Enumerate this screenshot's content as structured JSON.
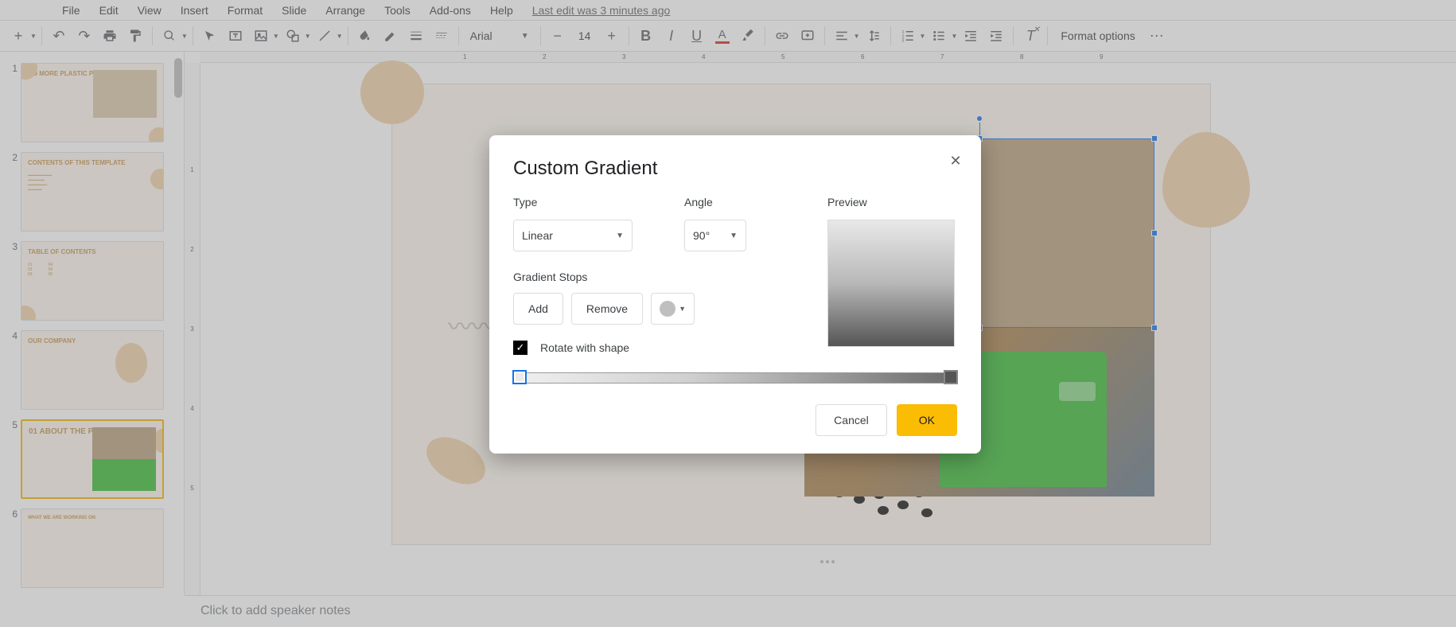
{
  "menubar": {
    "items": [
      "File",
      "Edit",
      "View",
      "Insert",
      "Format",
      "Slide",
      "Arrange",
      "Tools",
      "Add-ons",
      "Help"
    ],
    "last_edit": "Last edit was 3 minutes ago"
  },
  "toolbar": {
    "font": "Arial",
    "font_size": "14",
    "format_options": "Format options"
  },
  "sidebar": {
    "slides": [
      {
        "num": "1",
        "title": "NO MORE PLASTIC PROJECT PROPOSAL"
      },
      {
        "num": "2",
        "title": "CONTENTS OF THIS TEMPLATE"
      },
      {
        "num": "3",
        "title": "TABLE OF CONTENTS"
      },
      {
        "num": "4",
        "title": "OUR COMPANY"
      },
      {
        "num": "5",
        "title": "01 ABOUT THE PROJECT"
      },
      {
        "num": "6",
        "title": "WHAT WE ARE WORKING ON"
      }
    ],
    "selected_index": 4
  },
  "hruler_ticks": [
    "1",
    "2",
    "3",
    "4",
    "5",
    "6",
    "7",
    "8",
    "9"
  ],
  "vruler_ticks": [
    "1",
    "2",
    "3",
    "4",
    "5"
  ],
  "dialog": {
    "title": "Custom Gradient",
    "type_label": "Type",
    "type_value": "Linear",
    "angle_label": "Angle",
    "angle_value": "90°",
    "preview_label": "Preview",
    "stops_label": "Gradient Stops",
    "add_label": "Add",
    "remove_label": "Remove",
    "rotate_label": "Rotate with shape",
    "rotate_checked": true,
    "cancel": "Cancel",
    "ok": "OK"
  },
  "notes": {
    "placeholder": "Click to add speaker notes"
  }
}
